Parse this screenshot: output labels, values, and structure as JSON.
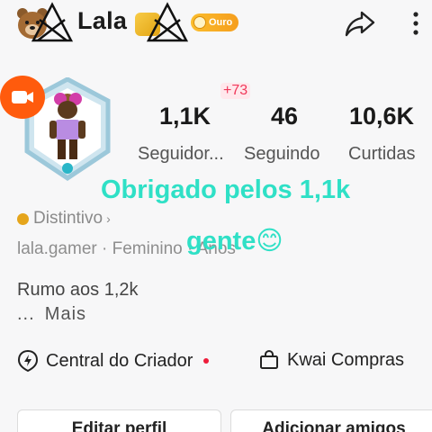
{
  "header": {
    "username": "Lala",
    "level_badge": "Ouro",
    "icons": [
      "bear-icon",
      "gold-badge-icon",
      "share-icon",
      "more-icon"
    ]
  },
  "stats": {
    "new_followers_badge": "+73",
    "followers": {
      "value": "1,1K",
      "label": "Seguidor..."
    },
    "following": {
      "value": "46",
      "label": "Seguindo"
    },
    "likes": {
      "value": "10,6K",
      "label": "Curtidas"
    }
  },
  "caption": {
    "line1": "Obrigado pelos 1,1k",
    "line2": "gente😊"
  },
  "profile": {
    "badge_label": "Distintivo",
    "meta": "lala.gamer · Feminino · Anos",
    "bio": "Rumo aos 1,2k",
    "more": "Mais",
    "more_prefix": "..."
  },
  "actions": {
    "creator_center": "Central do Criador",
    "shop": "Kwai Compras"
  },
  "buttons": {
    "edit_profile": "Editar perfil",
    "add_friends": "Adicionar amigos"
  },
  "colors": {
    "accent_orange": "#ff5b0d",
    "caption_cyan": "#2fe0c6",
    "badge_red": "#f0385a",
    "gold": "#f5a51c"
  }
}
